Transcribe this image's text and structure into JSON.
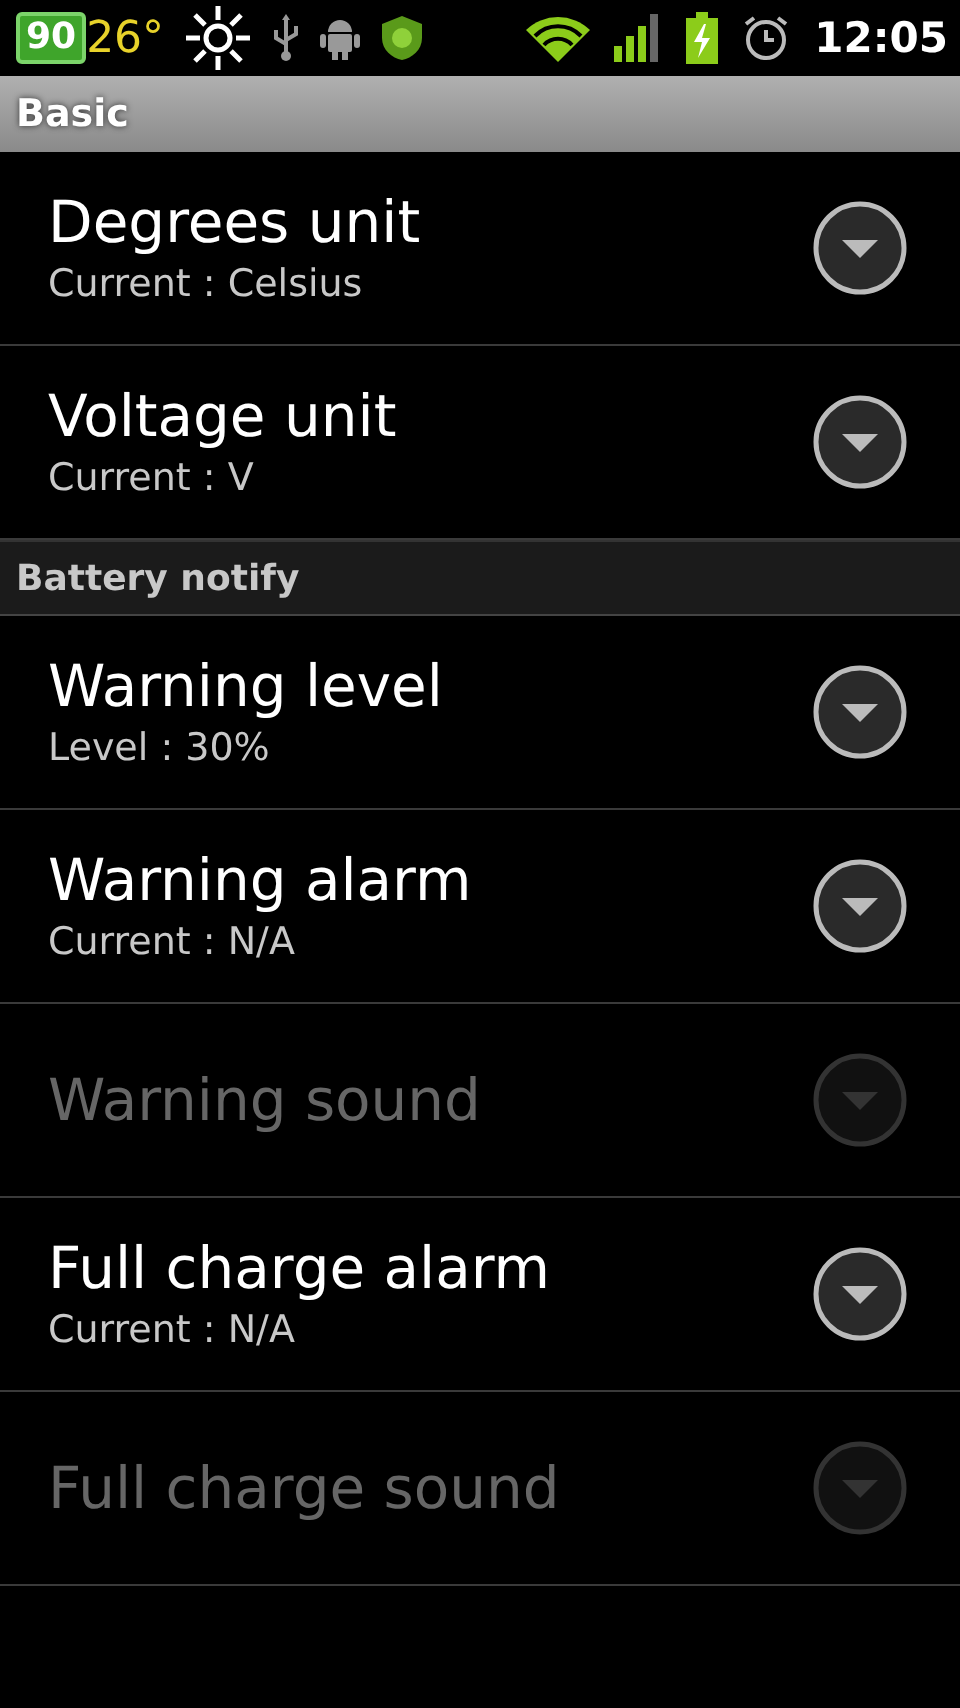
{
  "status_bar": {
    "battery_percent": "90",
    "temperature": "26°",
    "time": "12:05"
  },
  "sections": [
    {
      "title": "Basic",
      "kind": "primary",
      "items": [
        {
          "title": "Degrees unit",
          "summary": "Current : Celsius",
          "disabled": false
        },
        {
          "title": "Voltage unit",
          "summary": "Current : V",
          "disabled": false
        }
      ]
    },
    {
      "title": "Battery notify",
      "kind": "secondary",
      "items": [
        {
          "title": "Warning level",
          "summary": "Level : 30%",
          "disabled": false
        },
        {
          "title": "Warning alarm",
          "summary": "Current : N/A",
          "disabled": false
        },
        {
          "title": "Warning sound",
          "disabled": true
        },
        {
          "title": "Full charge alarm",
          "summary": "Current : N/A",
          "disabled": false
        },
        {
          "title": "Full charge sound",
          "disabled": true
        }
      ]
    }
  ]
}
